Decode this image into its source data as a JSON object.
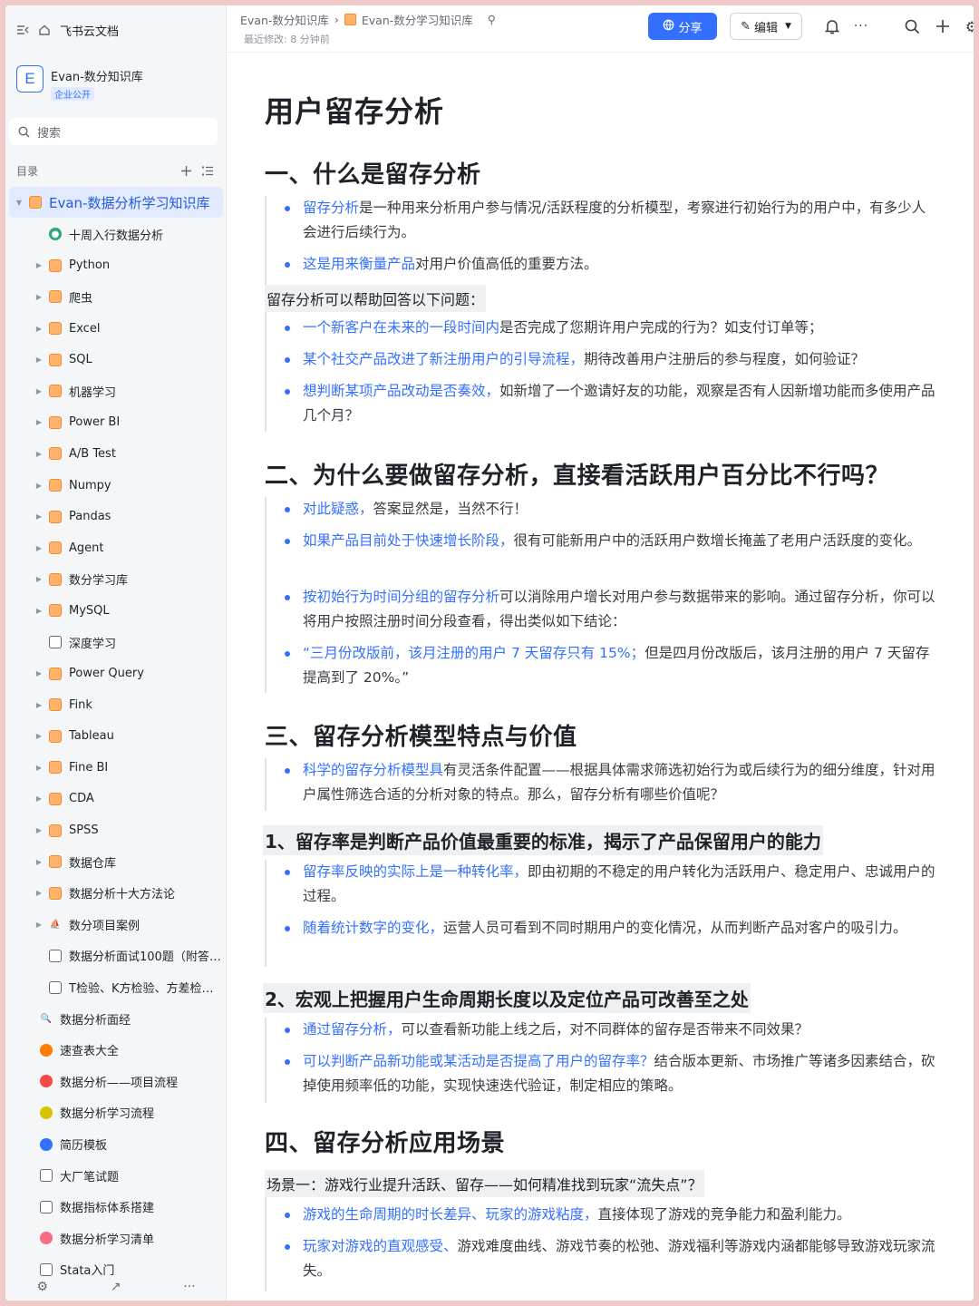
{
  "sidebar": {
    "app_name": "飞书云文档",
    "kb_name": "Evan-数分知识库",
    "kb_badge": "企业公开",
    "search_placeholder": "搜索",
    "toc_label": "目录",
    "root": "Evan-数据分析学习知识库",
    "tree": [
      {
        "label": "十周入行数据分析",
        "icon": "globe-icon"
      },
      {
        "label": "Python",
        "icon": "knowledge-base-icon"
      },
      {
        "label": "爬虫",
        "icon": "knowledge-base-icon"
      },
      {
        "label": "Excel",
        "icon": "knowledge-base-icon"
      },
      {
        "label": "SQL",
        "icon": "knowledge-base-icon"
      },
      {
        "label": "机器学习",
        "icon": "knowledge-base-icon"
      },
      {
        "label": "Power BI",
        "icon": "knowledge-base-icon"
      },
      {
        "label": "A/B Test",
        "icon": "knowledge-base-icon"
      },
      {
        "label": "Numpy",
        "icon": "knowledge-base-icon"
      },
      {
        "label": "Pandas",
        "icon": "knowledge-base-icon"
      },
      {
        "label": "Agent",
        "icon": "knowledge-base-icon"
      },
      {
        "label": "数分学习库",
        "icon": "knowledge-base-icon"
      },
      {
        "label": "MySQL",
        "icon": "knowledge-base-icon"
      },
      {
        "label": "深度学习",
        "icon": "doc-icon"
      },
      {
        "label": "Power Query",
        "icon": "knowledge-base-icon"
      },
      {
        "label": "Fink",
        "icon": "knowledge-base-icon"
      },
      {
        "label": "Tableau",
        "icon": "knowledge-base-icon"
      },
      {
        "label": "Fine BI",
        "icon": "knowledge-base-icon"
      },
      {
        "label": "CDA",
        "icon": "knowledge-base-icon"
      },
      {
        "label": "SPSS",
        "icon": "knowledge-base-icon"
      },
      {
        "label": "数据仓库",
        "icon": "knowledge-base-icon"
      },
      {
        "label": "数据分析十大方法论",
        "icon": "knowledge-base-icon"
      },
      {
        "label": "数分项目案例",
        "icon": "ship-icon"
      },
      {
        "label": "数据分析面试100题（附答案...",
        "icon": "doc-icon"
      },
      {
        "label": "T检验、K方检验、方差检验...",
        "icon": "doc-icon"
      },
      {
        "label": "数据分析面经",
        "icon": "magnifier-icon"
      },
      {
        "label": "速查表大全",
        "icon": "tangerine-icon"
      },
      {
        "label": "数据分析——项目流程",
        "icon": "apple-icon"
      },
      {
        "label": "数据分析学习流程",
        "icon": "coin-icon"
      },
      {
        "label": "简历模板",
        "icon": "briefcase-icon"
      },
      {
        "label": "大厂笔试题",
        "icon": "doc-icon"
      },
      {
        "label": "数据指标体系搭建",
        "icon": "doc-icon"
      },
      {
        "label": "数据分析学习清单",
        "icon": "badge-icon"
      },
      {
        "label": "Stata入门",
        "icon": "doc-icon"
      }
    ]
  },
  "header": {
    "crumb_1": "Evan-数分知识库",
    "crumb_2": "Evan-数分学习知识库",
    "meta": "最近修改: 8 分钟前",
    "share_label": "分享",
    "edit_label": "编辑"
  },
  "doc": {
    "title": "用户留存分析",
    "s1_heading": "一、什么是留存分析",
    "s1_b1_blue": "留存分析",
    "s1_b1_rest": "是一种用来分析用户参与情况/活跃程度的分析模型，考察进行初始行为的用户中，有多少人会进行后续行为。",
    "s1_b2_blue": "这是用来衡量产品",
    "s1_b2_rest": "对用户价值高低的重要方法。",
    "s1_hl": "留存分析可以帮助回答以下问题：",
    "s1_q1_blue": "一个新客户在未来的一段时间内",
    "s1_q1_rest": "是否完成了您期许用户完成的行为？如支付订单等；",
    "s1_q2_blue": "某个社交产品改进了新注册用户的引导流程，",
    "s1_q2_rest": "期待改善用户注册后的参与程度，如何验证？",
    "s1_q3_blue": "想判断某项产品改动是否奏效，",
    "s1_q3_rest": "如新增了一个邀请好友的功能，观察是否有人因新增功能而多使用产品几个月？",
    "s2_heading": "二、为什么要做留存分析，直接看活跃用户百分比不行吗？",
    "s2_b1_blue": "对此疑惑，",
    "s2_b1_rest": "答案显然是，当然不行！",
    "s2_b2_blue": "如果产品目前处于快速增长阶段，",
    "s2_b2_rest": "很有可能新用户中的活跃用户数增长掩盖了老用户活跃度的变化。",
    "s2_b3_blue": "按初始行为时间分组的留存分析",
    "s2_b3_rest": "可以消除用户增长对用户参与数据带来的影响。通过留存分析，你可以将用户按照注册时间分段查看，得出类似如下结论：",
    "s2_b4_blue": "“三月份改版前，该月注册的用户 7 天留存只有 15%；",
    "s2_b4_rest": "但是四月份改版后，该月注册的用户 7 天留存提高到了 20%。”",
    "s3_heading": "三、留存分析模型特点与价值",
    "s3_b1_blue": "科学的留存分析模型具",
    "s3_b1_rest": "有灵活条件配置——根据具体需求筛选初始行为或后续行为的细分维度，针对用户属性筛选合适的分析对象的特点。那么，留存分析有哪些价值呢？",
    "s3_sub1": "1、留存率是判断产品价值最重要的标准，揭示了产品保留用户的能力",
    "s3_sub1_b1_blue": "留存率反映的实际上是一种转化率，",
    "s3_sub1_b1_rest": "即由初期的不稳定的用户转化为活跃用户、稳定用户、忠诚用户的过程。",
    "s3_sub1_b2_blue": "随着统计数字的变化，",
    "s3_sub1_b2_rest": "运营人员可看到不同时期用户的变化情况，从而判断产品对客户的吸引力。",
    "s3_sub2": "2、宏观上把握用户生命周期长度以及定位产品可改善至之处",
    "s3_sub2_b1_blue": "通过留存分析，",
    "s3_sub2_b1_rest": "可以查看新功能上线之后，对不同群体的留存是否带来不同效果？",
    "s3_sub2_b2_blue": "可以判断产品新功能或某活动是否提高了用户的留存率？",
    "s3_sub2_b2_rest": "结合版本更新、市场推广等诸多因素结合，砍掉使用频率低的功能，实现快速迭代验证，制定相应的策略。",
    "s4_heading": "四、留存分析应用场景",
    "s4_hl": "场景一：游戏行业提升活跃、留存——如何精准找到玩家“流失点”？",
    "s4_b1_blue": "游戏的生命周期的时长差异、玩家的游戏粘度，",
    "s4_b1_rest": "直接体现了游戏的竞争能力和盈利能力。",
    "s4_b2_blue": "玩家对游戏的直观感受、",
    "s4_b2_rest": "游戏难度曲线、游戏节奏的松弛、游戏福利等游戏内涵都能够导致游戏玩家流失。"
  },
  "colors": {
    "accent": "#3370ff",
    "root_bg": "#e1eaff",
    "highlight_bg": "#eff0f1"
  }
}
